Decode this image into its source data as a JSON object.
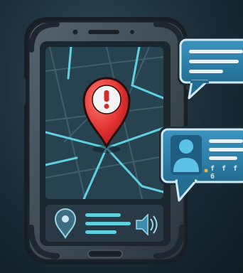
{
  "illustration": {
    "subject": "phone-map-alert",
    "colors": {
      "background": "#1b2c36",
      "phone_frame": "#3b4750",
      "map_background": "#284350",
      "map_roads": "#5fd0e0",
      "alert_pin": "#e23a3a",
      "bubble_fill": "#2e7fa8",
      "bubble_line": "#cfe8f2",
      "contact_avatar": "#5cc3e6",
      "accent_dot": "#f2b233"
    }
  },
  "contact_bubble": {
    "signal_text": "f f f 6"
  }
}
